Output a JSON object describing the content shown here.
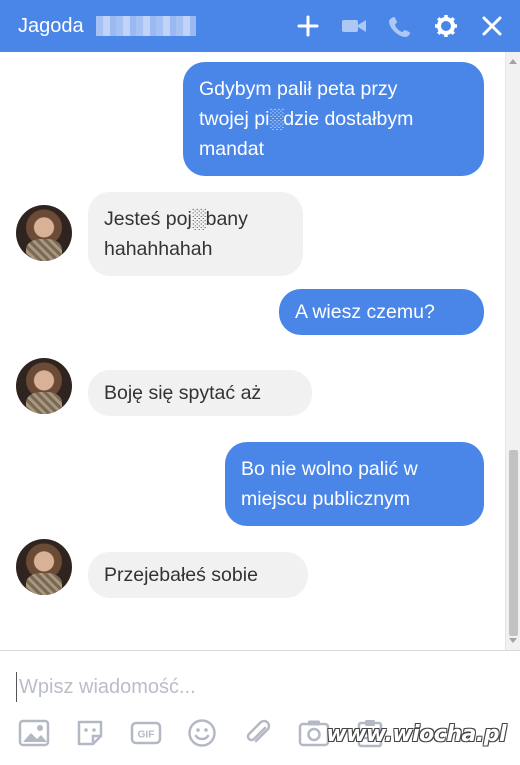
{
  "header": {
    "contact_name": "Jagoda",
    "icons": [
      "plus-icon",
      "video-camera-icon",
      "phone-icon",
      "gear-icon",
      "close-icon"
    ],
    "accent_color": "#4a86e8"
  },
  "messages": [
    {
      "side": "out",
      "lines": [
        "Gdybym palił peta przy",
        "twojej pi░dzie dostałbym",
        "mandat"
      ]
    },
    {
      "side": "in",
      "lines": [
        "Jesteś poj░bany",
        "hahahhahah"
      ]
    },
    {
      "side": "out",
      "lines": [
        "A wiesz czemu?"
      ]
    },
    {
      "side": "in",
      "lines": [
        "Boję się spytać aż"
      ]
    },
    {
      "side": "out",
      "lines": [
        "Bo nie wolno palić w",
        "miejscu publicznym"
      ]
    },
    {
      "side": "in",
      "lines": [
        "Przejebałeś sobie"
      ]
    }
  ],
  "composer": {
    "placeholder": "Wpisz wiadomość...",
    "tools": [
      "image-icon",
      "sticker-icon",
      "gif-icon",
      "emoji-icon",
      "attachment-icon",
      "camera-icon",
      "clipboard-icon"
    ]
  },
  "watermark": "www.wiocha.pl"
}
